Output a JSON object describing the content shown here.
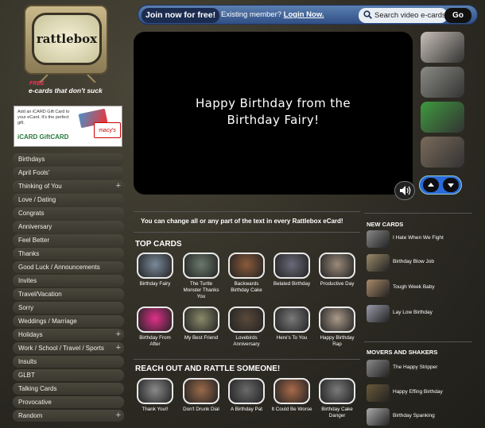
{
  "brand": {
    "logo_text": "rattlebox",
    "tagline": "e-cards that don't suck",
    "tagline_free": "FREE"
  },
  "ad": {
    "text": "Add an iCARD Gift Card to your eCard. It's the perfect gift.",
    "logo": "iCARD GiftCARD",
    "store": "macy's"
  },
  "categories": [
    {
      "label": "Birthdays",
      "expandable": false
    },
    {
      "label": "April Fools'",
      "expandable": false
    },
    {
      "label": "Thinking of You",
      "expandable": true
    },
    {
      "label": "Love / Dating",
      "expandable": false
    },
    {
      "label": "Congrats",
      "expandable": false
    },
    {
      "label": "Anniversary",
      "expandable": false
    },
    {
      "label": "Feel Better",
      "expandable": false
    },
    {
      "label": "Thanks",
      "expandable": false
    },
    {
      "label": "Good Luck / Announcements",
      "expandable": false
    },
    {
      "label": "Invites",
      "expandable": false
    },
    {
      "label": "Travel/Vacation",
      "expandable": false
    },
    {
      "label": "Sorry",
      "expandable": false
    },
    {
      "label": "Weddings / Marriage",
      "expandable": false
    },
    {
      "label": "Holidays",
      "expandable": true
    },
    {
      "label": "Work / School / Travel / Sports",
      "expandable": true
    },
    {
      "label": "Insults",
      "expandable": false
    },
    {
      "label": "GLBT",
      "expandable": false
    },
    {
      "label": "Talking Cards",
      "expandable": false
    },
    {
      "label": "Provocative",
      "expandable": false
    },
    {
      "label": "Random",
      "expandable": true
    }
  ],
  "topbar": {
    "join_label": "Join now for free!",
    "existing_label": "Existing member?",
    "login_label": "Login Now.",
    "search_placeholder": "Search video e-cards",
    "go_label": "Go"
  },
  "player": {
    "line1": "Happy Birthday from the",
    "line2": "Birthday Fairy!"
  },
  "side_thumbs": [
    "person-arms-up",
    "vintage-photo",
    "gift-card",
    "child-face"
  ],
  "info_text": "You can change all or any part of the text in every Rattlebox eCard!",
  "top_cards": {
    "title": "TOP CARDS",
    "items": [
      {
        "label": "Birthday Fairy",
        "color": "#7a8a9a"
      },
      {
        "label": "The Turtle Monster Thanks You",
        "color": "#6a7a6a"
      },
      {
        "label": "Backwards Birthday Cake",
        "color": "#8a5a3a"
      },
      {
        "label": "Belated Birthday",
        "color": "#6a6a7a"
      },
      {
        "label": "Productive Day",
        "color": "#9a8a7a"
      },
      {
        "label": "Birthday From After",
        "color": "#e0308a"
      },
      {
        "label": "My Best Friend",
        "color": "#8a8a6a"
      },
      {
        "label": "Lovebirds Anniversary",
        "color": "#5a4a3a"
      },
      {
        "label": "Here's To You",
        "color": "#7a7a7a"
      },
      {
        "label": "Happy Birthday Rap",
        "color": "#aa9a8a"
      }
    ]
  },
  "rattle": {
    "title": "REACH OUT AND RATTLE SOMEONE!",
    "items": [
      {
        "label": "Thank You!!",
        "color": "#8a8a8a"
      },
      {
        "label": "Don't Drunk Dial",
        "color": "#9a6a4a"
      },
      {
        "label": "A Birthday Pat",
        "color": "#6a6a6a"
      },
      {
        "label": "It Could Be Worse",
        "color": "#aa6a4a"
      },
      {
        "label": "Birthday Cake Danger",
        "color": "#7a7a7a"
      }
    ]
  },
  "new_cards": {
    "title": "NEW CARDS",
    "items": [
      {
        "label": "I Hate When We Fight",
        "color": "#888"
      },
      {
        "label": "Birthday Blow Job",
        "color": "#9a8a6a"
      },
      {
        "label": "Tough Week Baby",
        "color": "#aa8a6a"
      },
      {
        "label": "Lay Low Birthday",
        "color": "#9a9aaa"
      }
    ]
  },
  "movers": {
    "title": "MOVERS AND SHAKERS",
    "items": [
      {
        "label": "The Happy Stripper",
        "color": "#8a8a8a"
      },
      {
        "label": "Happy Effing Birthday",
        "color": "#6a5a3a"
      },
      {
        "label": "Birthday Spanking",
        "color": "#aaaaaa"
      }
    ]
  }
}
